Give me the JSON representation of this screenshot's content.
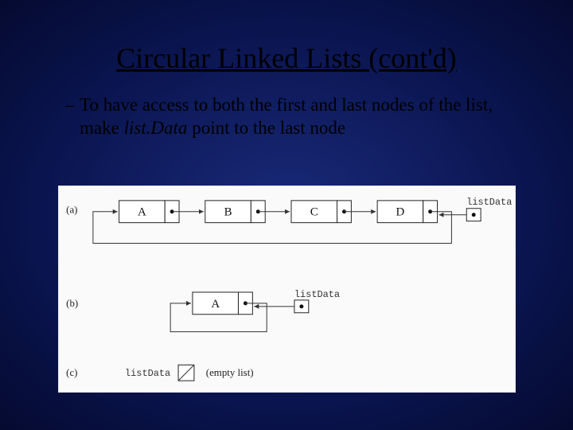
{
  "slide": {
    "title": "Circular Linked Lists (cont'd)",
    "bullet": {
      "prefix": "– ",
      "text_before_italic": "To have access to both the first and last nodes of the list, make ",
      "italic": "list.Data",
      "text_after_italic": " point to the last node"
    }
  },
  "diagram": {
    "rows": [
      {
        "label": "(a)",
        "nodes": [
          "A",
          "B",
          "C",
          "D"
        ],
        "pointer_label": "listData"
      },
      {
        "label": "(b)",
        "nodes": [
          "A"
        ],
        "pointer_label": "listData"
      },
      {
        "label": "(c)",
        "pointer_name": "listData",
        "caption": "(empty list)"
      }
    ]
  }
}
